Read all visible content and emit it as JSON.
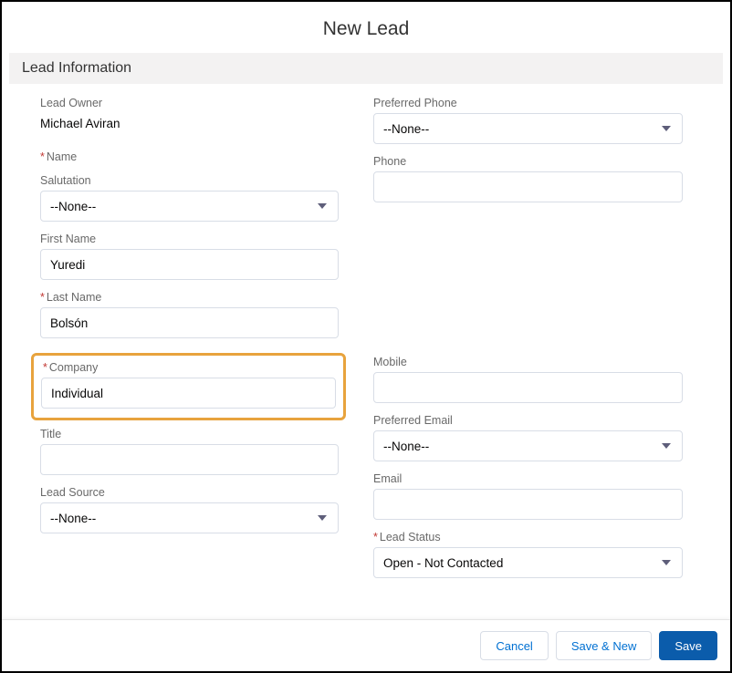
{
  "modal": {
    "title": "New Lead"
  },
  "section": {
    "heading": "Lead Information"
  },
  "left": {
    "leadOwner": {
      "label": "Lead Owner",
      "value": "Michael Aviran"
    },
    "name": {
      "label": "Name"
    },
    "salutation": {
      "label": "Salutation",
      "value": "--None--"
    },
    "firstName": {
      "label": "First Name",
      "value": "Yuredi"
    },
    "lastName": {
      "label": "Last Name",
      "value": "Bolsón"
    },
    "company": {
      "label": "Company",
      "value": "Individual"
    },
    "title": {
      "label": "Title",
      "value": ""
    },
    "leadSource": {
      "label": "Lead Source",
      "value": "--None--"
    }
  },
  "right": {
    "preferredPhone": {
      "label": "Preferred Phone",
      "value": "--None--"
    },
    "phone": {
      "label": "Phone",
      "value": ""
    },
    "mobile": {
      "label": "Mobile",
      "value": ""
    },
    "preferredEmail": {
      "label": "Preferred Email",
      "value": "--None--"
    },
    "email": {
      "label": "Email",
      "value": ""
    },
    "leadStatus": {
      "label": "Lead Status",
      "value": "Open - Not Contacted"
    }
  },
  "footer": {
    "cancel": "Cancel",
    "saveNew": "Save & New",
    "save": "Save"
  }
}
